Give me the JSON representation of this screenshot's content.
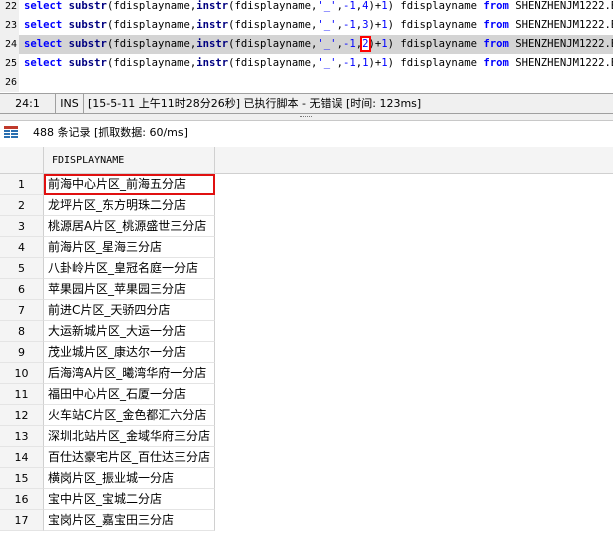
{
  "editor": {
    "lines": [
      {
        "num": "22",
        "pre": "select ",
        "fn": "substr",
        "mid1": "(fdisplayname,",
        "fn2": "instr",
        "mid2": "(fdisplayname,",
        "str": "'_'",
        "mid3": ",",
        "num1": "-1",
        "mid4": ",",
        "num2": "4",
        "mid5": ")+",
        "num3": "1",
        "mid6": ") fdisplayname ",
        "kw2": "from",
        "tail": " SHENZHENJM1222.B",
        "current": false,
        "hl": false
      },
      {
        "num": "23",
        "pre": "select ",
        "fn": "substr",
        "mid1": "(fdisplayname,",
        "fn2": "instr",
        "mid2": "(fdisplayname,",
        "str": "'_'",
        "mid3": ",",
        "num1": "-1",
        "mid4": ",",
        "num2": "3",
        "mid5": ")+",
        "num3": "1",
        "mid6": ") fdisplayname ",
        "kw2": "from",
        "tail": " SHENZHENJM1222.B",
        "current": false,
        "hl": false
      },
      {
        "num": "24",
        "pre": "select ",
        "fn": "substr",
        "mid1": "(fdisplayname,",
        "fn2": "instr",
        "mid2": "(fdisplayname,",
        "str": "'_'",
        "mid3": ",",
        "num1": "-1",
        "mid4": ",",
        "num2": "2",
        "mid5": ")+",
        "num3": "1",
        "mid6": ") fdisplayname ",
        "kw2": "from",
        "tail": " SHENZHENJM1222.B",
        "current": true,
        "hl": true
      },
      {
        "num": "25",
        "pre": "select ",
        "fn": "substr",
        "mid1": "(fdisplayname,",
        "fn2": "instr",
        "mid2": "(fdisplayname,",
        "str": "'_'",
        "mid3": ",",
        "num1": "-1",
        "mid4": ",",
        "num2": "1",
        "mid5": ")+",
        "num3": "1",
        "mid6": ") fdisplayname ",
        "kw2": "from",
        "tail": " SHENZHENJM1222.B",
        "current": false,
        "hl": false
      },
      {
        "num": "26",
        "empty": true
      }
    ]
  },
  "status": {
    "position": "24:1",
    "mode": "INS",
    "message": "[15-5-11 上午11时28分26秒] 已执行脚本 - 无错误  [时间: 123ms]"
  },
  "result": {
    "record_label": "488 条记录 [抓取数据: 60/ms]",
    "column": "FDISPLAYNAME",
    "rows": [
      {
        "n": "1",
        "v": "前海中心片区_前海五分店",
        "selected": true
      },
      {
        "n": "2",
        "v": "龙坪片区_东方明珠二分店"
      },
      {
        "n": "3",
        "v": "桃源居A片区_桃源盛世三分店"
      },
      {
        "n": "4",
        "v": "前海片区_星海三分店"
      },
      {
        "n": "5",
        "v": "八卦岭片区_皇冠名庭一分店"
      },
      {
        "n": "6",
        "v": "苹果园片区_苹果园三分店"
      },
      {
        "n": "7",
        "v": "前进C片区_天骄四分店"
      },
      {
        "n": "8",
        "v": "大运新城片区_大运一分店"
      },
      {
        "n": "9",
        "v": "茂业城片区_康达尔一分店"
      },
      {
        "n": "10",
        "v": "后海湾A片区_曦湾华府一分店"
      },
      {
        "n": "11",
        "v": "福田中心片区_石厦一分店"
      },
      {
        "n": "12",
        "v": "火车站C片区_金色都汇六分店"
      },
      {
        "n": "13",
        "v": "深圳北站片区_金域华府三分店"
      },
      {
        "n": "14",
        "v": "百仕达豪宅片区_百仕达三分店"
      },
      {
        "n": "15",
        "v": "横岗片区_振业城一分店"
      },
      {
        "n": "16",
        "v": "宝中片区_宝城二分店"
      },
      {
        "n": "17",
        "v": "宝岗片区_嘉宝田三分店"
      }
    ]
  },
  "colors": {
    "highlight": "#e01010",
    "keyword": "#0000ff",
    "current_line": "#d4d4d4"
  },
  "icons": {
    "result_grid": "grid-icon"
  }
}
